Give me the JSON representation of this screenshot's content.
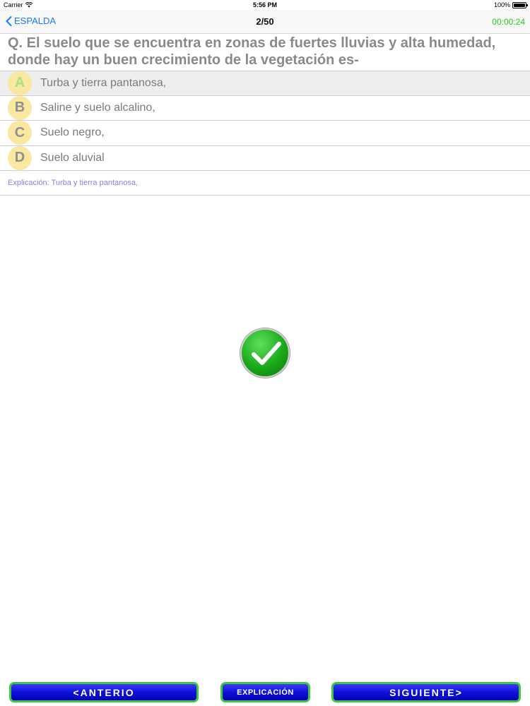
{
  "status_bar": {
    "carrier": "Carrier",
    "time": "5:56 PM",
    "battery": "100%"
  },
  "nav": {
    "back_label": "ESPALDA",
    "progress": "2/50",
    "timer": "00:00:24",
    "accent": "#1a7cf5",
    "timer_color": "#22cc22"
  },
  "question": {
    "text": "Q. El suelo que se encuentra en zonas de fuertes lluvias y alta humedad, donde hay un buen crecimiento de la vegetación es-"
  },
  "options": [
    {
      "letter": "A",
      "text": "Turba y tierra pantanosa,",
      "selected": true
    },
    {
      "letter": "B",
      "text": "Saline y suelo alcalino,",
      "selected": false
    },
    {
      "letter": "C",
      "text": "Suelo negro,",
      "selected": false
    },
    {
      "letter": "D",
      "text": "Suelo aluvial",
      "selected": false
    }
  ],
  "explanation": "Explicación: Turba y tierra pantanosa,",
  "result": {
    "icon": "check-icon",
    "color": "#1aa81a"
  },
  "buttons": {
    "prev": "<ANTERIO",
    "explain": "EXPLICACIÓN",
    "next": "SIGUIENTE>"
  }
}
